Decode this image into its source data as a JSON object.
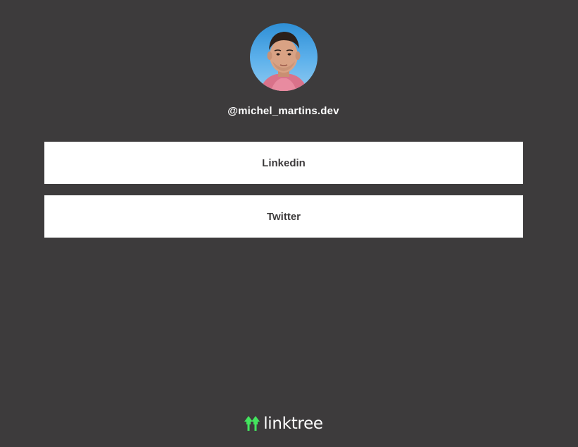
{
  "profile": {
    "handle": "@michel_martins.dev"
  },
  "links": [
    {
      "label": "Linkedin"
    },
    {
      "label": "Twitter"
    }
  ],
  "footer": {
    "brand": "linktree",
    "brand_icon": "linktree-logo-icon",
    "brand_color": "#43e55e"
  },
  "colors": {
    "background": "#3d3b3c",
    "button_bg": "#ffffff",
    "button_text": "#3d3b3c"
  }
}
